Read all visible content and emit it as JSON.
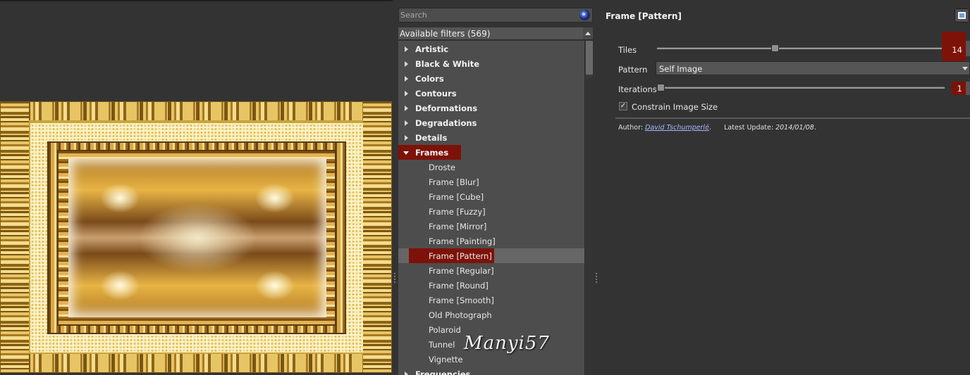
{
  "preview": {
    "watermark": "Manyi57"
  },
  "filters": {
    "search_placeholder": "Search",
    "header": "Available filters (569)",
    "categories": [
      {
        "label": "Artistic",
        "open": false
      },
      {
        "label": "Black & White",
        "open": false
      },
      {
        "label": "Colors",
        "open": false
      },
      {
        "label": "Contours",
        "open": false
      },
      {
        "label": "Deformations",
        "open": false
      },
      {
        "label": "Degradations",
        "open": false
      },
      {
        "label": "Details",
        "open": false
      },
      {
        "label": "Frames",
        "open": true
      },
      {
        "label": "Frequencies",
        "open": false
      }
    ],
    "frames_items": [
      "Droste",
      "Frame [Blur]",
      "Frame [Cube]",
      "Frame [Fuzzy]",
      "Frame [Mirror]",
      "Frame [Painting]",
      "Frame [Pattern]",
      "Frame [Regular]",
      "Frame [Round]",
      "Frame [Smooth]",
      "Old Photograph",
      "Polaroid",
      "Tunnel",
      "Vignette"
    ],
    "selected_item": "Frame [Pattern]"
  },
  "panel": {
    "title": "Frame [Pattern]",
    "tiles_label": "Tiles",
    "tiles_value": "14",
    "tiles_fraction": 0.409,
    "pattern_label": "Pattern",
    "pattern_value": "Self Image",
    "iterations_label": "Iterations",
    "iterations_value": "1",
    "iterations_fraction": 0.0,
    "constrain_label": "Constrain Image Size",
    "constrain_checked": true,
    "author_label": "Author:",
    "author_name": "David Tschumperlé",
    "author_suffix": ".",
    "update_label": "Latest Update:",
    "update_value": "2014/01/08",
    "update_suffix": "."
  },
  "colors": {
    "accent": "#7d1208",
    "panel_bg": "#333333",
    "list_bg": "#4d4d4d"
  }
}
